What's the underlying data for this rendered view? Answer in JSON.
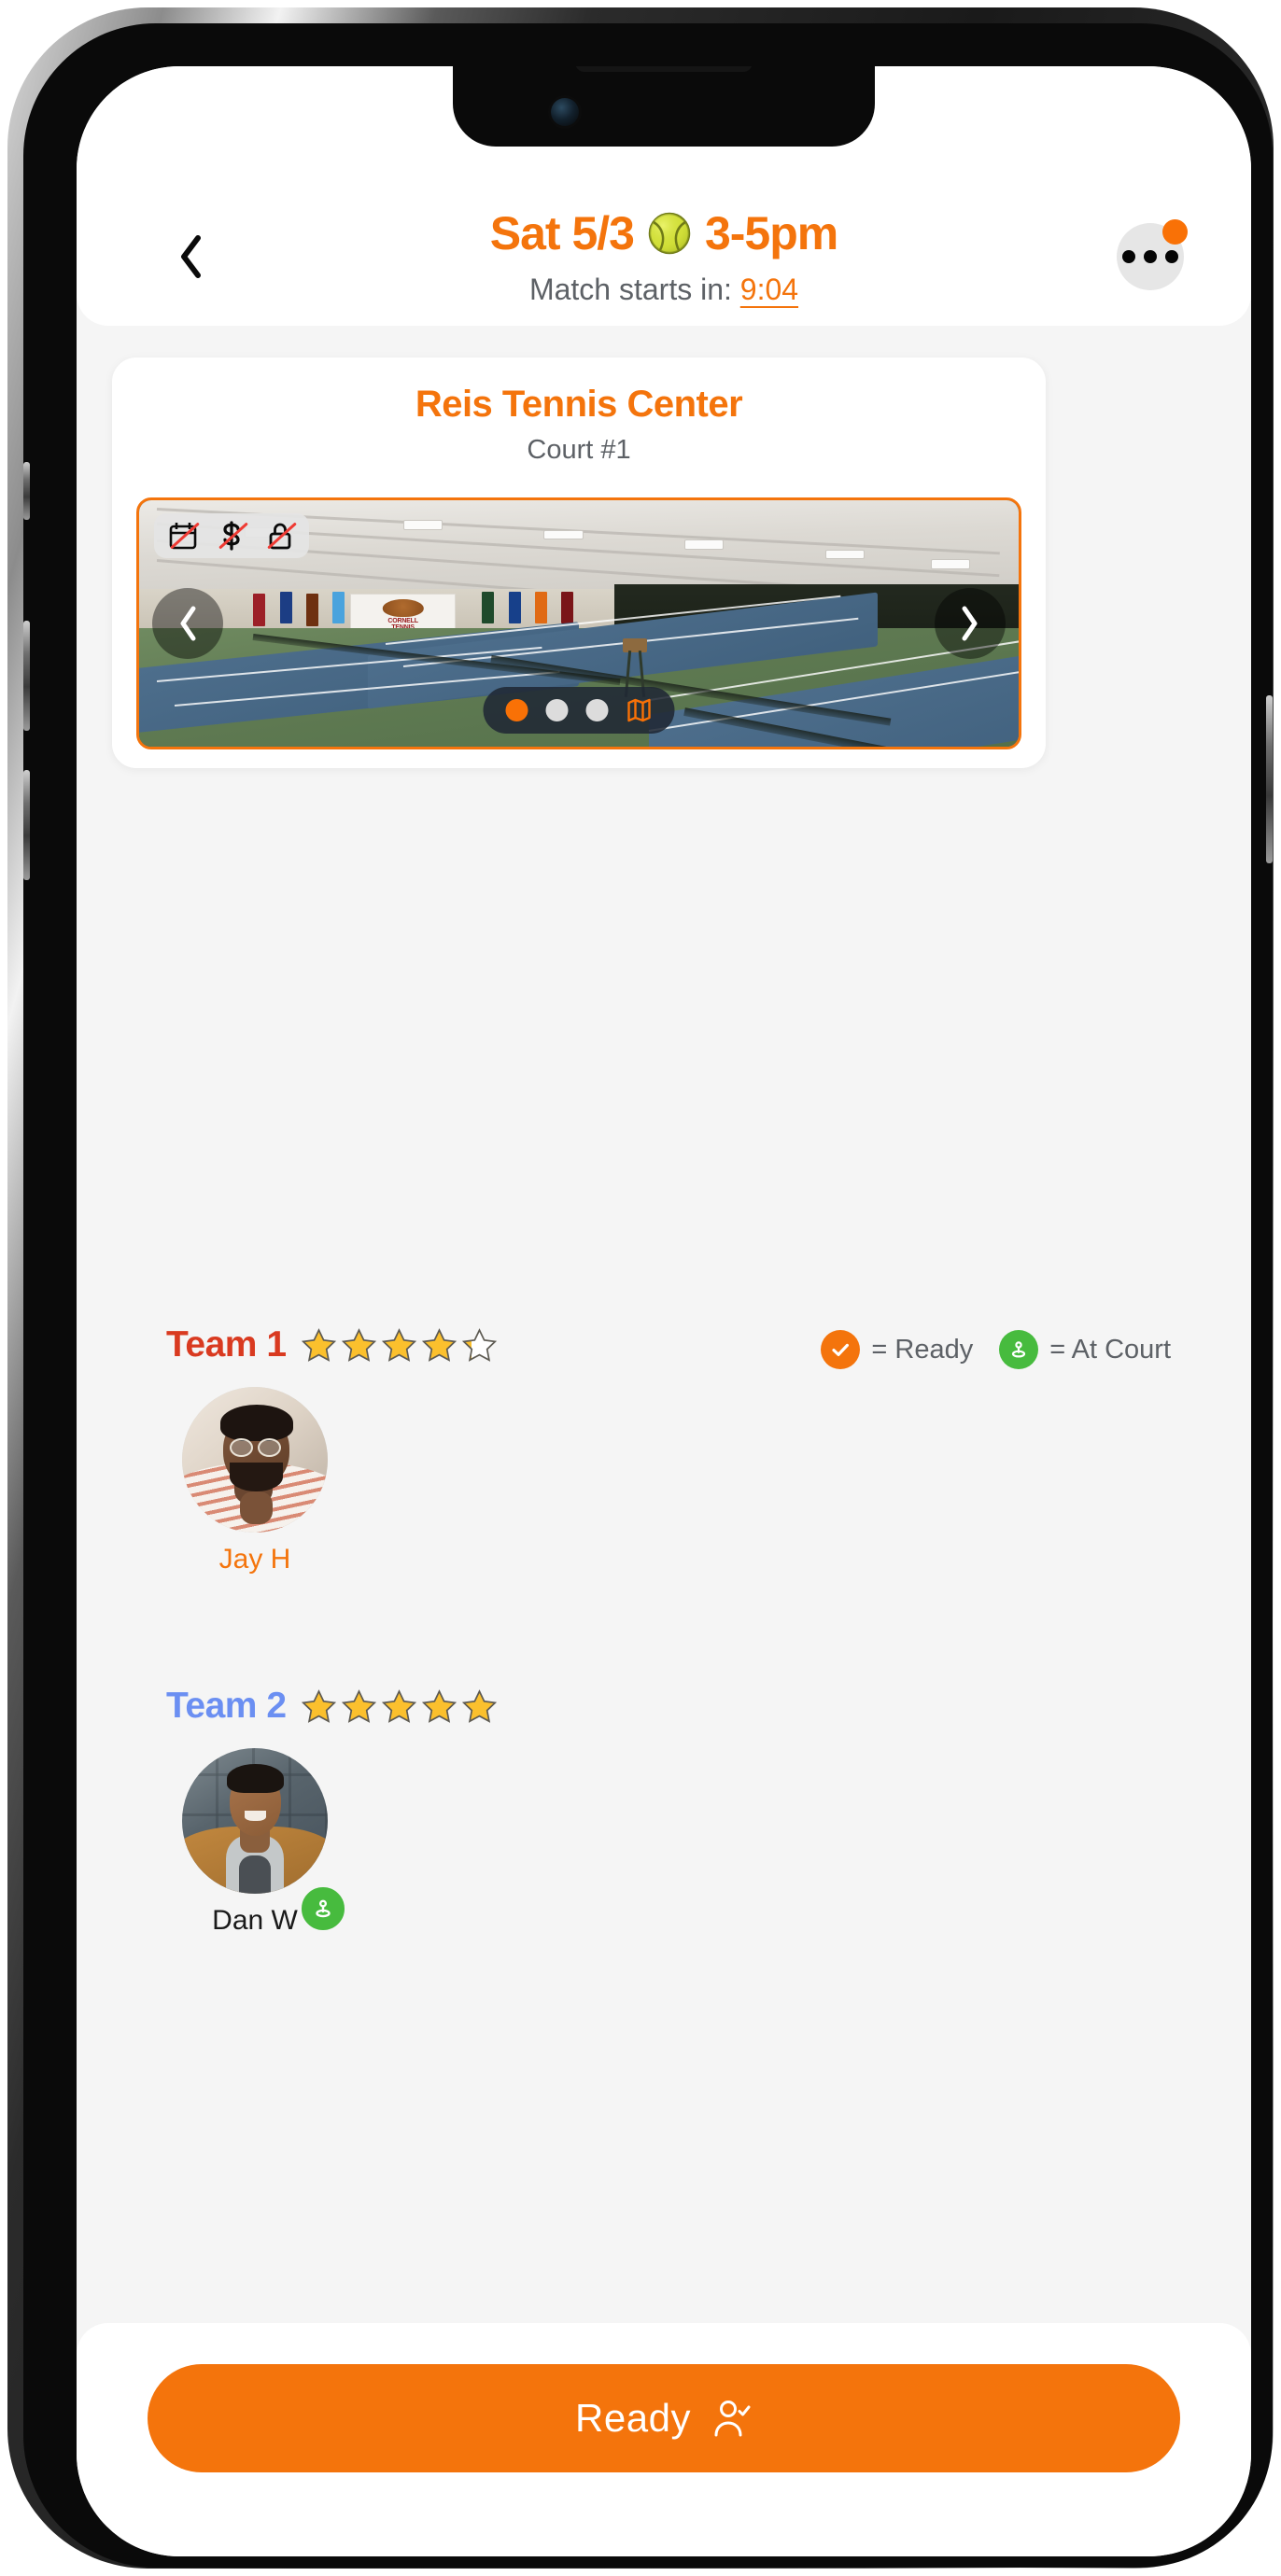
{
  "header": {
    "back_icon": "chevron-left-icon",
    "title": "Sat 5/3",
    "title_suffix": "3-5pm",
    "ball_icon": "tennis-ball-icon",
    "countdown_prefix": "Match starts in:",
    "countdown_value": "9:04",
    "more_icon": "more-horizontal-icon",
    "has_notification": true,
    "accent_color": "#f4740c",
    "muted_color": "#5d6166"
  },
  "venue": {
    "name": "Reis Tennis Center",
    "court": "Court #1",
    "photo_alt": "Indoor tennis courts at Cornell Tennis Center",
    "badges": [
      {
        "icon": "calendar-off-icon",
        "label": "No reservation required"
      },
      {
        "icon": "dollar-off-icon",
        "label": "No fee"
      },
      {
        "icon": "lock-off-icon",
        "label": "No lock"
      }
    ],
    "carousel": {
      "prev_icon": "chevron-left-icon",
      "next_icon": "chevron-right-icon",
      "total_slides": 3,
      "active_slide": 1,
      "map_icon": "map-icon"
    }
  },
  "legend": [
    {
      "icon": "check-circle-icon",
      "color": "#f4740c",
      "text": "= Ready"
    },
    {
      "icon": "location-pin-icon",
      "color": "#47bb3e",
      "text": "= At Court"
    }
  ],
  "teams": [
    {
      "label": "Team 1",
      "color": "#d93a20",
      "rating": 4.25,
      "stars_total": 5,
      "players": [
        {
          "name": "Jay H",
          "name_color": "#f4740c",
          "status": "ready",
          "status_badge": null
        }
      ]
    },
    {
      "label": "Team 2",
      "color": "#6b8ff2",
      "rating": 5,
      "stars_total": 5,
      "players": [
        {
          "name": "Dan W",
          "name_color": "#1a1a1a",
          "status": "at-court",
          "status_badge": "location-pin-icon"
        }
      ]
    }
  ],
  "footer": {
    "ready_label": "Ready",
    "ready_icon": "person-check-icon",
    "ready_color": "#f4740c"
  }
}
